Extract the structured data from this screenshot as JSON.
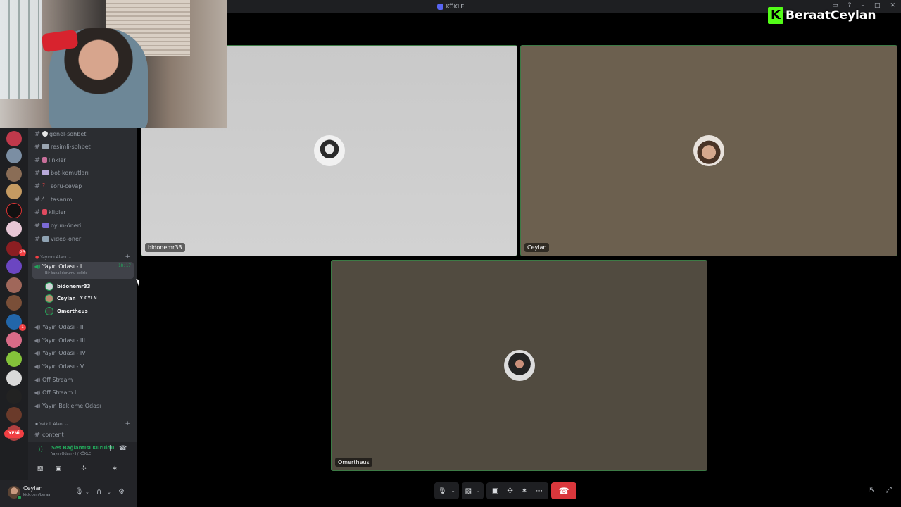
{
  "window": {
    "title": "KÖKLE"
  },
  "watermark": {
    "brand": "BeraatCeylan",
    "logo_letter": "K",
    "brand_color": "#53fc18"
  },
  "server_rail": {
    "badges": [
      "23",
      "1"
    ],
    "new_badge": "YENİ"
  },
  "channels": {
    "text": [
      {
        "name": "genel-sohbet",
        "icon": "speech-balloon-icon"
      },
      {
        "name": "resimli-sohbet",
        "icon": "picture-icon"
      },
      {
        "name": "linkler",
        "icon": "link-icon"
      },
      {
        "name": "bot-komutları",
        "icon": "robot-icon"
      },
      {
        "name": "soru-cevap",
        "icon": "question-mark-icon"
      },
      {
        "name": "tasarım",
        "icon": "pencil-icon"
      },
      {
        "name": "klipler",
        "icon": "pin-icon"
      },
      {
        "name": "oyun-öneri",
        "icon": "gamepad-icon"
      },
      {
        "name": "video-öneri",
        "icon": "video-icon"
      }
    ],
    "category_streamer": "Yayıncı Alanı",
    "active_voice": {
      "name": "Yayın Odası - I",
      "timer": "18:17",
      "status": "Bir kanal durumu belirle"
    },
    "members": [
      {
        "name": "bidonemr33",
        "tag": ""
      },
      {
        "name": "Ceylan",
        "tag": "CYLN"
      },
      {
        "name": "Omertheus",
        "tag": ""
      }
    ],
    "voice": [
      "Yayın Odası - II",
      "Yayın Odası - III",
      "Yayın Odası - IV",
      "Yayın Odası - V",
      "Off Stream",
      "Off Stream II",
      "Yayın Bekleme Odası"
    ],
    "category_staff": "Yetkili Alanı",
    "staff_text": "content"
  },
  "voice_connection": {
    "status": "Ses Bağlantısı Kuruldu",
    "location": "Yayın Odası - I / KÖKLE"
  },
  "user": {
    "name": "Ceylan",
    "subtitle": "kick.com/beraa"
  },
  "tiles": [
    {
      "label": "bidonemr33"
    },
    {
      "label": "Ceylan"
    },
    {
      "label": "Omertheus"
    }
  ],
  "colors": {
    "online_green": "#23a55a",
    "leave_red": "#da373c",
    "tile_border": "#3c7a45"
  }
}
